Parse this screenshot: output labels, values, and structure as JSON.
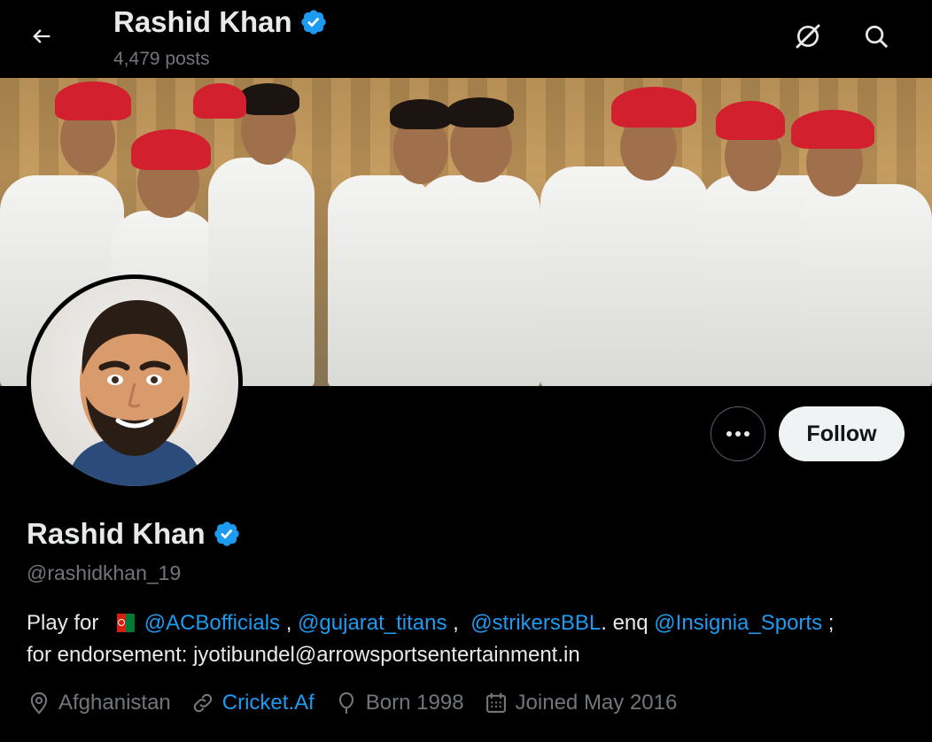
{
  "header": {
    "title": "Rashid Khan",
    "posts_count": "4,479 posts"
  },
  "icons": {
    "back": "arrow-left-icon",
    "grok": "grok-icon",
    "search": "search-icon",
    "verified": "verified-badge-icon",
    "more": "more-icon"
  },
  "profile": {
    "name": "Rashid Khan",
    "handle": "@rashidkhan_19",
    "follow_label": "Follow"
  },
  "bio": {
    "prefix": "Play for",
    "mention_1": "@ACBofficials",
    "sep_1": " , ",
    "mention_2": "@gujarat_titans",
    "sep_2": " ,  ",
    "mention_3": "@strikersBBL",
    "sep_3": ". enq ",
    "mention_4": "@Insignia_Sports",
    "sep_4": " ;",
    "line_2": "for endorsement: jyotibundel@arrowsportsentertainment.in"
  },
  "meta": {
    "location": "Afghanistan",
    "website": "Cricket.Af",
    "birth": "Born 1998",
    "joined": "Joined May 2016"
  },
  "colors": {
    "background": "#000000",
    "accent": "#1d9bf0",
    "muted": "#71767b",
    "verified": "#1d9bf0"
  }
}
